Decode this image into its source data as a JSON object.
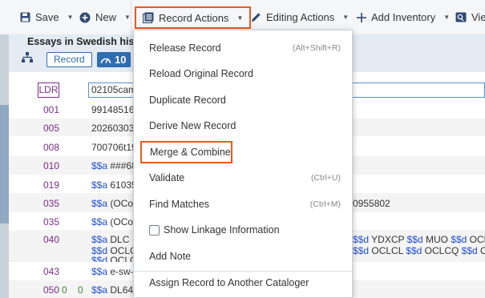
{
  "toolbar": {
    "save": "Save",
    "new": "New",
    "record_actions": "Record Actions",
    "editing_actions": "Editing Actions",
    "add_inventory": "Add Inventory",
    "view": "Vie"
  },
  "header": {
    "title": "Essays in Swedish histor",
    "record_badge": "Record",
    "gauge_value": "10"
  },
  "marc": {
    "ldr": {
      "tag": "LDR",
      "value": "02105cam"
    },
    "rows": [
      {
        "tag": "001",
        "content": "99148516"
      },
      {
        "tag": "005",
        "content": "20260303"
      },
      {
        "tag": "008",
        "content": "700706t19"
      },
      {
        "tag": "010",
        "sub": "$$a",
        "content": " ###68",
        "right": ""
      },
      {
        "tag": "019",
        "sub": "$$a",
        "content": " 61035"
      },
      {
        "tag": "035",
        "sub": "$$a",
        "content": " (OCoL",
        "right": "0955802"
      },
      {
        "tag": "035",
        "sub": "$$a",
        "content": " (OCoL"
      },
      {
        "tag": "040",
        "sub": "$$a",
        "content": " DLC",
        "line2_sub": "$$d",
        "line2": " OCLC",
        "line3_sub": "$$d",
        "line3": " OCLC",
        "right1": [
          {
            "s": "$$d",
            "t": " YDXCP "
          },
          {
            "s": "$$d",
            "t": " MUO "
          },
          {
            "s": "$$d",
            "t": " OCL"
          }
        ],
        "right2": [
          {
            "s": "$$d",
            "t": " OCLCL "
          },
          {
            "s": "$$d",
            "t": " OCLCQ "
          },
          {
            "s": "$$d",
            "t": " OCL"
          }
        ]
      },
      {
        "tag": "043",
        "sub": "$$a",
        "content": " e-sw-"
      },
      {
        "tag": "050",
        "ind1": "0",
        "ind2": "0",
        "sub": "$$a",
        "content": " DL64"
      }
    ]
  },
  "menu": {
    "items": [
      {
        "label": "Release Record",
        "shortcut": "(Alt+Shift+R)"
      },
      {
        "label": "Reload Original Record",
        "shortcut": ""
      },
      {
        "label": "Duplicate Record",
        "shortcut": ""
      },
      {
        "label": "Derive New Record",
        "shortcut": ""
      },
      {
        "label": "Merge & Combine",
        "shortcut": ""
      },
      {
        "label": "Validate",
        "shortcut": "(Ctrl+U)"
      },
      {
        "label": "Find Matches",
        "shortcut": "(Ctrl+M)"
      },
      {
        "label": "Show Linkage Information",
        "shortcut": ""
      },
      {
        "label": "Add Note",
        "shortcut": ""
      },
      {
        "label": "Assign Record to Another Cataloger",
        "shortcut": ""
      }
    ]
  },
  "colors": {
    "accent": "#2f6db1",
    "highlight": "#ea5a1f",
    "tag": "#7b2d8a",
    "subfield": "#1f4fd0",
    "indicator": "#3a8a2f"
  }
}
